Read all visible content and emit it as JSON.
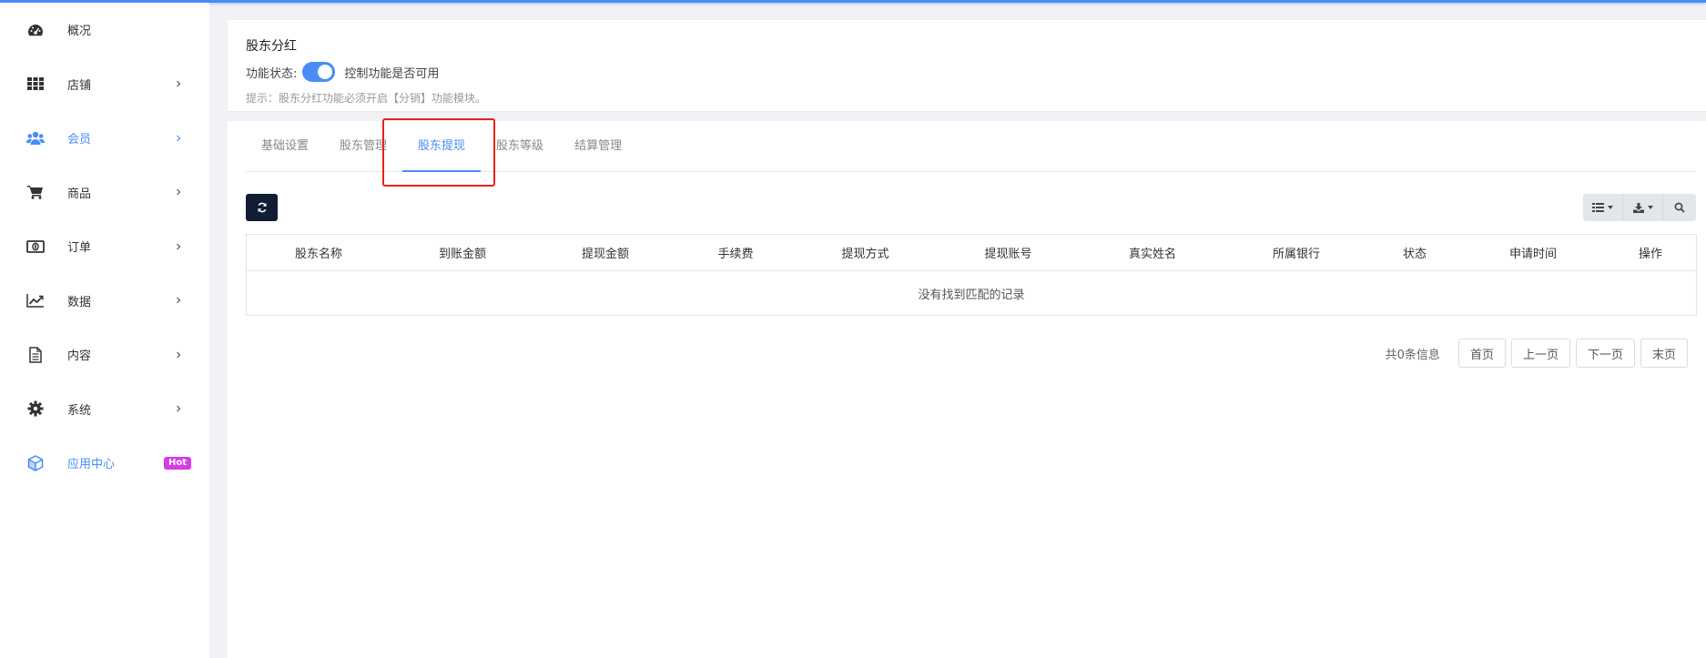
{
  "colors": {
    "accent": "#4a8cf7",
    "hot": "#d63ce3",
    "highlight": "#e8221b",
    "dark_button": "#0f1d35"
  },
  "sidebar": {
    "items": [
      {
        "label": "概况",
        "icon": "dashboard-icon",
        "has_chevron": false
      },
      {
        "label": "店铺",
        "icon": "grid-icon",
        "has_chevron": true
      },
      {
        "label": "会员",
        "icon": "users-icon",
        "has_chevron": true,
        "active": true
      },
      {
        "label": "商品",
        "icon": "cart-icon",
        "has_chevron": true
      },
      {
        "label": "订单",
        "icon": "money-icon",
        "has_chevron": true
      },
      {
        "label": "数据",
        "icon": "line-chart-icon",
        "has_chevron": true
      },
      {
        "label": "内容",
        "icon": "document-icon",
        "has_chevron": true
      },
      {
        "label": "系统",
        "icon": "gear-icon",
        "has_chevron": true
      },
      {
        "label": "应用中心",
        "icon": "cube-icon",
        "has_chevron": false,
        "badge": "Hot"
      }
    ]
  },
  "feature": {
    "title": "股东分红",
    "status_label": "功能状态:",
    "toggle_on": true,
    "toggle_text": "控制功能是否可用",
    "hint": "提示：股东分红功能必须开启【分销】功能模块。"
  },
  "tabs": [
    {
      "label": "基础设置"
    },
    {
      "label": "股东管理"
    },
    {
      "label": "股东提现",
      "active": true
    },
    {
      "label": "股东等级"
    },
    {
      "label": "结算管理"
    }
  ],
  "toolbar": {
    "refresh_icon": "refresh-icon",
    "columns_icon": "columns-icon",
    "export_icon": "download-icon",
    "search_icon": "search-icon"
  },
  "table": {
    "columns": [
      "股东名称",
      "到账金额",
      "提现金额",
      "手续费",
      "提现方式",
      "提现账号",
      "真实姓名",
      "所属银行",
      "状态",
      "申请时间",
      "操作"
    ],
    "empty_text": "没有找到匹配的记录"
  },
  "pagination": {
    "info": "共0条信息",
    "first": "首页",
    "prev": "上一页",
    "next": "下一页",
    "last": "末页"
  }
}
